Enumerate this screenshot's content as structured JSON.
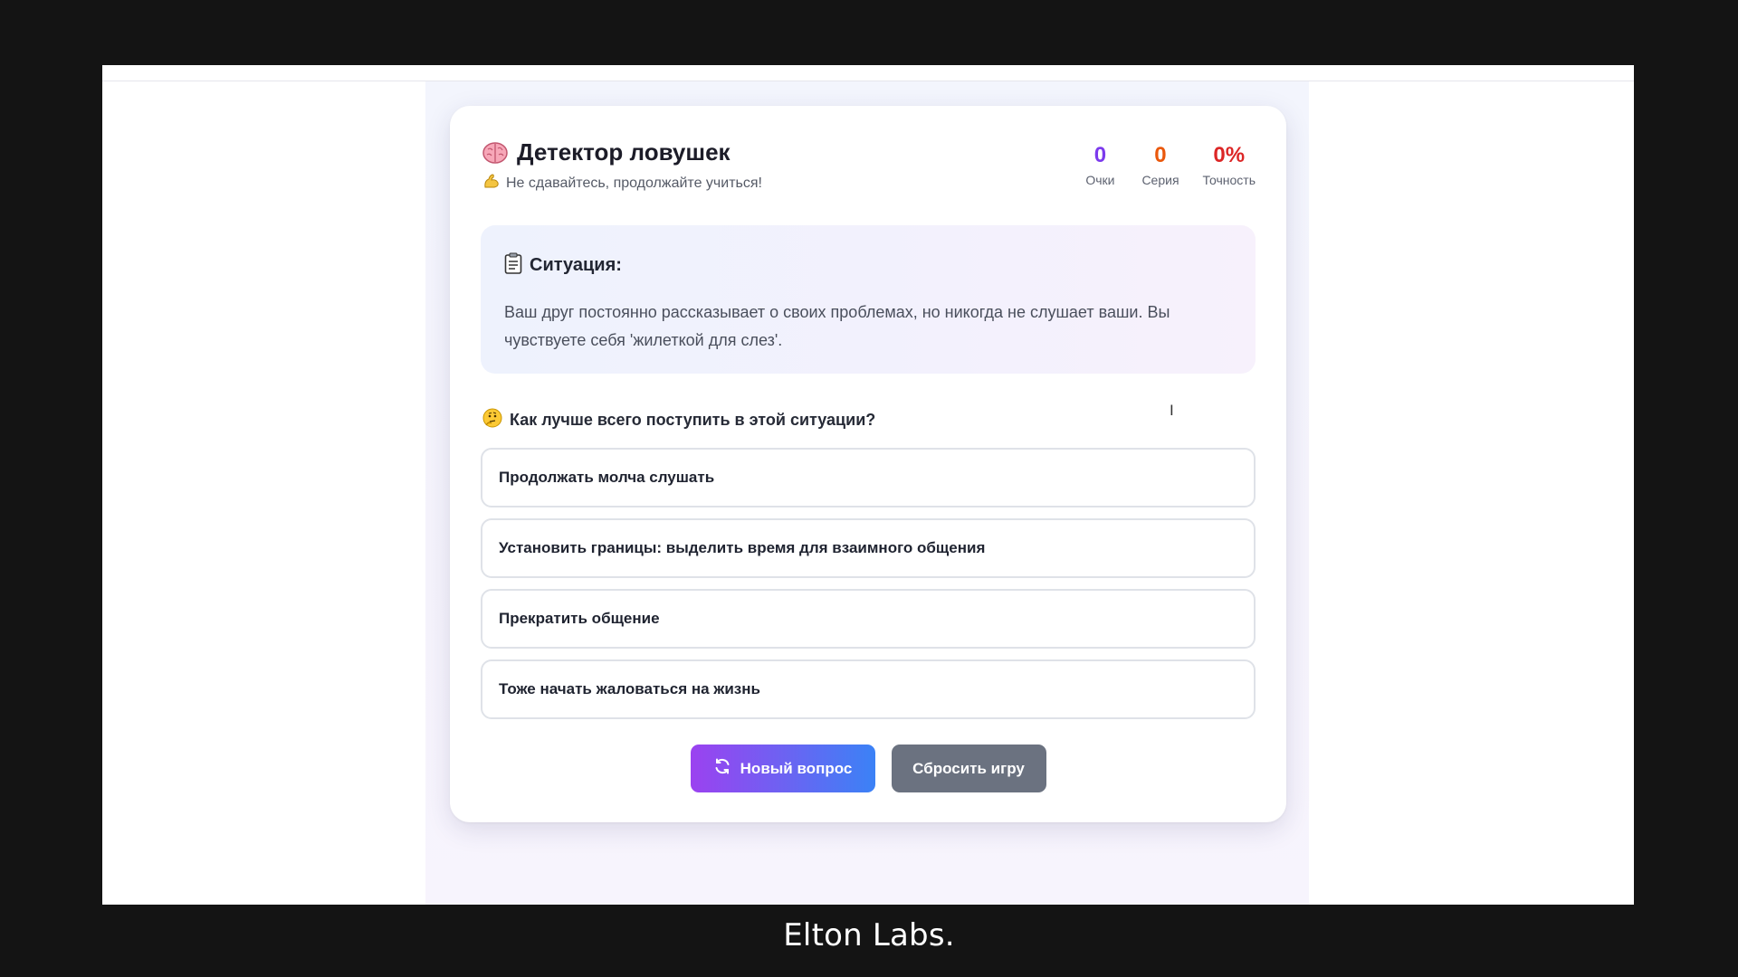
{
  "header": {
    "title": "Детектор ловушек",
    "subtitle": "Не сдавайтесь, продолжайте учиться!",
    "title_icon": "brain-icon",
    "subtitle_icon": "flexed-biceps-icon"
  },
  "stats": [
    {
      "value": "0",
      "label": "Очки",
      "color": "#7c3aed"
    },
    {
      "value": "0",
      "label": "Серия",
      "color": "#ea580c"
    },
    {
      "value": "0%",
      "label": "Точность",
      "color": "#dc2626"
    }
  ],
  "situation": {
    "icon": "clipboard-icon",
    "title": "Ситуация:",
    "text": "Ваш друг постоянно рассказывает о своих проблемах, но никогда не слушает ваши. Вы чувствуете себя 'жилеткой для слез'."
  },
  "question": {
    "icon": "thinking-face-icon",
    "text": "Как лучше всего поступить в этой ситуации?"
  },
  "options": [
    "Продолжать молча слушать",
    "Установить границы: выделить время для взаимного общения",
    "Прекратить общение",
    "Тоже начать жаловаться на жизнь"
  ],
  "buttons": {
    "new_question": "Новый вопрос",
    "reset": "Сбросить игру"
  },
  "branding": "Elton Labs.",
  "colors": {
    "accent_start": "#9b42f0",
    "accent_end": "#3b82f6",
    "reset_button": "#6b7280"
  }
}
